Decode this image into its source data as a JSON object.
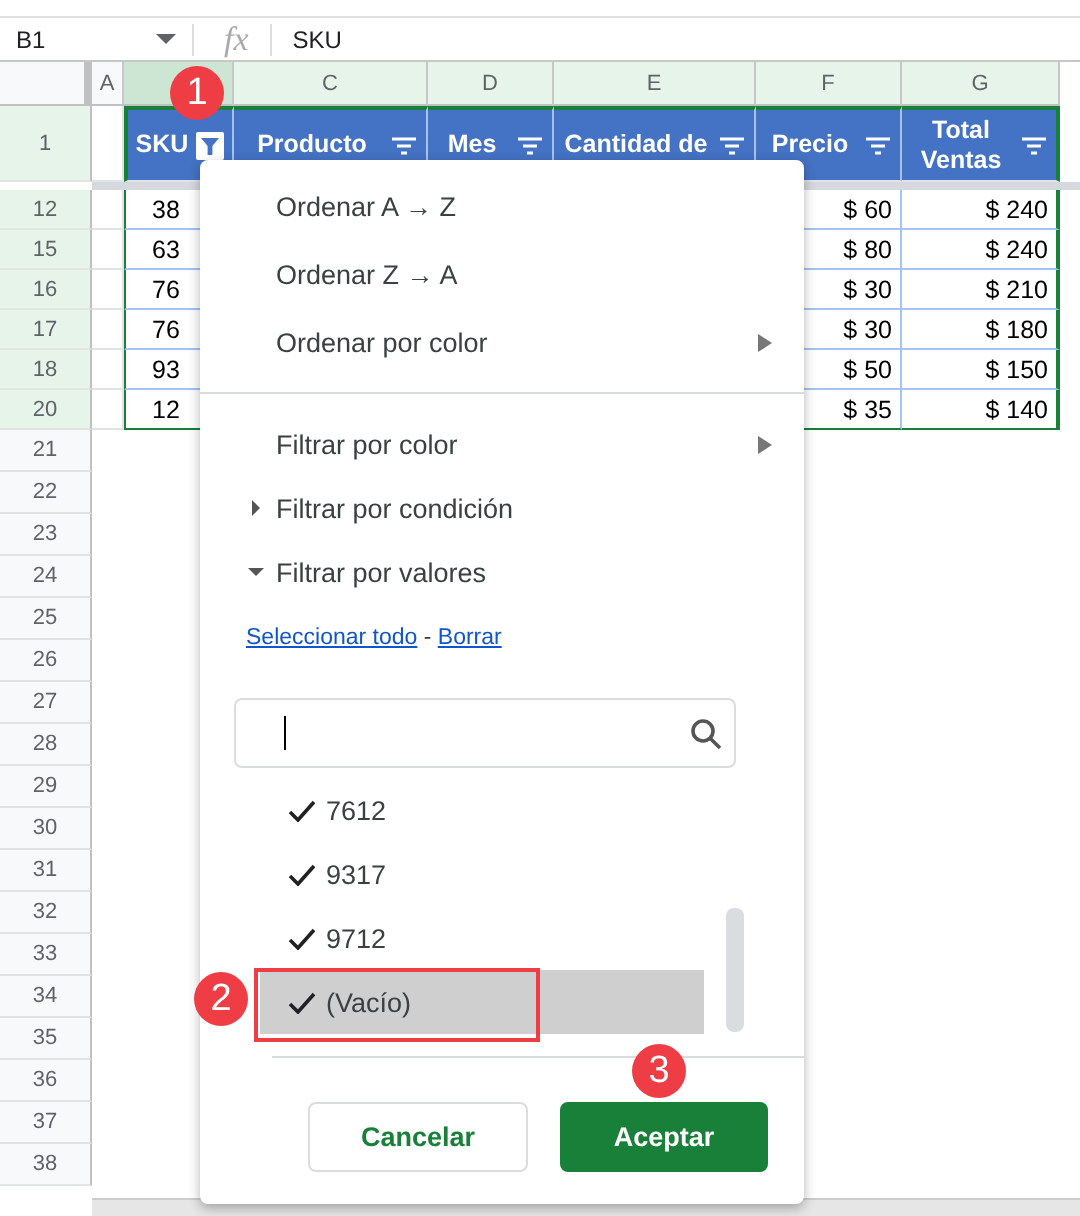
{
  "formula_bar": {
    "cell_ref": "B1",
    "fx": "fx",
    "content": "SKU"
  },
  "columns": [
    {
      "letter": "A"
    },
    {
      "header": "SKU",
      "filter_active": true
    },
    {
      "letter": "C",
      "header": "Producto",
      "filter_active": false
    },
    {
      "letter": "D",
      "header": "Mes",
      "filter_active": false
    },
    {
      "letter": "E",
      "header": "Cantidad de",
      "filter_active": false
    },
    {
      "letter": "F",
      "header": "Precio",
      "filter_active": false
    },
    {
      "letter": "G",
      "header": "Total Ventas",
      "filter_active": false
    }
  ],
  "header_row_number": "1",
  "rows": [
    {
      "number": "12",
      "sku": "38",
      "precio": "$ 60",
      "total_ventas": "$ 240"
    },
    {
      "number": "15",
      "sku": "63",
      "precio": "$ 80",
      "total_ventas": "$ 240"
    },
    {
      "number": "16",
      "sku": "76",
      "precio": "$ 30",
      "total_ventas": "$ 210"
    },
    {
      "number": "17",
      "sku": "76",
      "precio": "$ 30",
      "total_ventas": "$ 180"
    },
    {
      "number": "18",
      "sku": "93",
      "precio": "$ 50",
      "total_ventas": "$ 150"
    },
    {
      "number": "20",
      "sku": "12",
      "precio": "$ 35",
      "total_ventas": "$ 140"
    }
  ],
  "empty_rows": [
    "21",
    "22",
    "23",
    "24",
    "25",
    "26",
    "27",
    "28",
    "29",
    "30",
    "31",
    "32",
    "33",
    "34",
    "35",
    "36",
    "37",
    "38"
  ],
  "menu": {
    "items": [
      {
        "kind": "option",
        "label": "Ordenar A → Z",
        "submenu": false
      },
      {
        "kind": "option",
        "label": "Ordenar Z → A",
        "submenu": false
      },
      {
        "kind": "option",
        "label": "Ordenar por color",
        "submenu": true
      },
      {
        "kind": "divider"
      },
      {
        "kind": "option",
        "label": "Filtrar por color",
        "submenu": true
      },
      {
        "kind": "section",
        "label": "Filtrar por condición",
        "expanded": false
      },
      {
        "kind": "section",
        "label": "Filtrar por valores",
        "expanded": true
      }
    ],
    "links": [
      "Seleccionar todo",
      "Borrar"
    ],
    "link_separator": "-",
    "search_field": {
      "focused": true
    },
    "values": [
      {
        "label": "7612",
        "checked": true,
        "selected": false
      },
      {
        "label": "9317",
        "checked": true,
        "selected": false
      },
      {
        "label": "9712",
        "checked": true,
        "selected": false
      },
      {
        "label": "(Vacío)",
        "checked": true,
        "selected": true
      }
    ],
    "buttons": [
      {
        "label": "Cancelar",
        "kind": "secondary"
      },
      {
        "label": "Aceptar",
        "kind": "primary"
      }
    ]
  },
  "annotations": [
    {
      "label": "1",
      "frame": false
    },
    {
      "label": "2",
      "frame": true
    },
    {
      "label": "3",
      "frame": false
    }
  ]
}
